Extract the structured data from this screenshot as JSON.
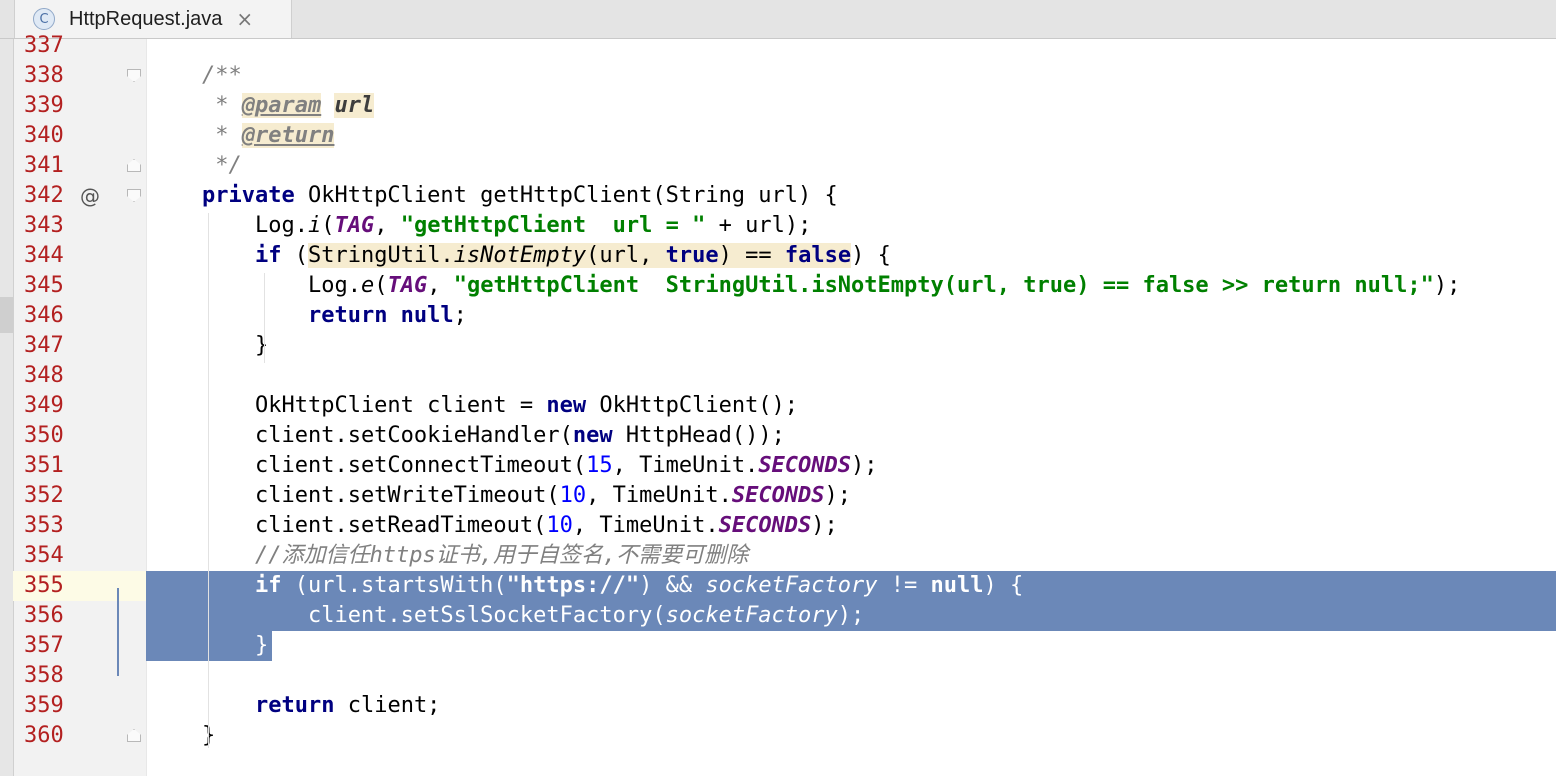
{
  "tab": {
    "icon_letter": "C",
    "filename": "HttpRequest.java",
    "close": "×"
  },
  "gutter_marker": "@",
  "lines": [
    {
      "num": "337",
      "code": ""
    },
    {
      "num": "338",
      "code": "/**"
    },
    {
      "num": "339",
      "code": " * @param url"
    },
    {
      "num": "340",
      "code": " * @return"
    },
    {
      "num": "341",
      "code": " */"
    },
    {
      "num": "342",
      "code": "private OkHttpClient getHttpClient(String url) {"
    },
    {
      "num": "343",
      "code": "    Log.i(TAG, \"getHttpClient  url = \" + url);"
    },
    {
      "num": "344",
      "code": "    if (StringUtil.isNotEmpty(url, true) == false) {"
    },
    {
      "num": "345",
      "code": "        Log.e(TAG, \"getHttpClient  StringUtil.isNotEmpty(url, true) == false >> return null;\");"
    },
    {
      "num": "346",
      "code": "        return null;"
    },
    {
      "num": "347",
      "code": "    }"
    },
    {
      "num": "348",
      "code": ""
    },
    {
      "num": "349",
      "code": "    OkHttpClient client = new OkHttpClient();"
    },
    {
      "num": "350",
      "code": "    client.setCookieHandler(new HttpHead());"
    },
    {
      "num": "351",
      "code": "    client.setConnectTimeout(15, TimeUnit.SECONDS);"
    },
    {
      "num": "352",
      "code": "    client.setWriteTimeout(10, TimeUnit.SECONDS);"
    },
    {
      "num": "353",
      "code": "    client.setReadTimeout(10, TimeUnit.SECONDS);"
    },
    {
      "num": "354",
      "code": "    //添加信任https证书,用于自签名,不需要可删除"
    },
    {
      "num": "355",
      "code": "    if (url.startsWith(\"https://\") && socketFactory != null) {"
    },
    {
      "num": "356",
      "code": "        client.setSslSocketFactory(socketFactory);"
    },
    {
      "num": "357",
      "code": "    }"
    },
    {
      "num": "358",
      "code": ""
    },
    {
      "num": "359",
      "code": "    return client;"
    },
    {
      "num": "360",
      "code": "}"
    }
  ],
  "colors": {
    "keyword": "#000080",
    "string": "#008000",
    "number": "#0000ff",
    "field": "#660e7a",
    "comment": "#808080",
    "line_number": "#b32020",
    "selection": "#6b88b8"
  }
}
